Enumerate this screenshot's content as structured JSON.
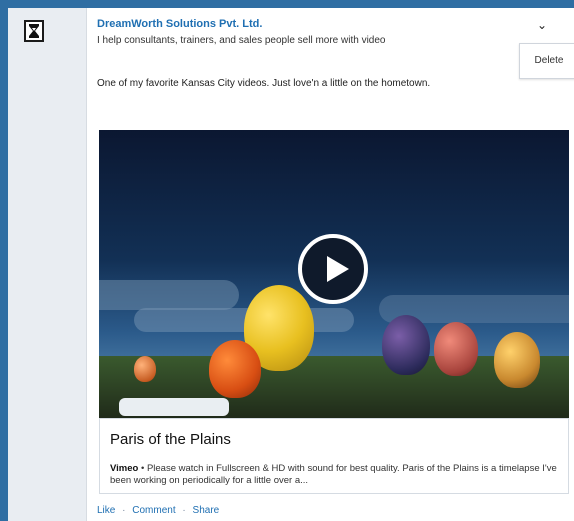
{
  "post": {
    "company_name": "DreamWorth Solutions Pvt. Ltd.",
    "tagline": "I help consultants, trainers, and sales people sell more with video",
    "status_text": "One of my favorite Kansas City videos. Just love'n a little on the hometown.",
    "delete_label": "Delete",
    "chevron_label": "⌄"
  },
  "video": {
    "title": "Paris of the Plains",
    "source": "Vimeo",
    "description": " • Please watch in Fullscreen & HD with sound for best quality. Paris of the Plains is a timelapse I've been working on periodically for a little over a..."
  },
  "actions": {
    "like": "Like",
    "comment": "Comment",
    "share": "Share",
    "separator": "·"
  },
  "colors": {
    "page_background": "#2f6ea3",
    "link_blue": "#1f6fb2"
  }
}
